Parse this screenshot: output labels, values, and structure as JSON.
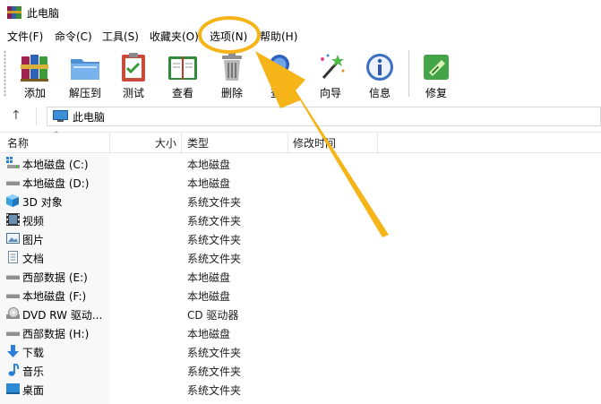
{
  "window": {
    "title": "此电脑"
  },
  "menu": [
    "文件(F)",
    "命令(C)",
    "工具(S)",
    "收藏夹(O)",
    "选项(N)",
    "帮助(H)"
  ],
  "toolbar": {
    "buttons": [
      {
        "label": "添加",
        "icon": "books-add-icon"
      },
      {
        "label": "解压到",
        "icon": "folder-extract-icon"
      },
      {
        "label": "测试",
        "icon": "clipboard-test-icon"
      },
      {
        "label": "查看",
        "icon": "open-book-view-icon"
      },
      {
        "label": "删除",
        "icon": "trash-delete-icon"
      },
      {
        "label": "查找",
        "icon": "magnifier-find-icon"
      },
      {
        "label": "向导",
        "icon": "magic-wand-wizard-icon"
      },
      {
        "label": "信息",
        "icon": "info-icon"
      },
      {
        "label": "修复",
        "icon": "first-aid-repair-icon"
      }
    ]
  },
  "address": {
    "path": "此电脑"
  },
  "columns": {
    "name": "名称",
    "size": "大小",
    "type": "类型",
    "modified": "修改时间"
  },
  "files": [
    {
      "name": "本地磁盘 (C:)",
      "type": "本地磁盘",
      "icon": "windows-drive-icon"
    },
    {
      "name": "本地磁盘 (D:)",
      "type": "本地磁盘",
      "icon": "drive-icon"
    },
    {
      "name": "3D 对象",
      "type": "系统文件夹",
      "icon": "3d-objects-icon"
    },
    {
      "name": "视频",
      "type": "系统文件夹",
      "icon": "video-icon"
    },
    {
      "name": "图片",
      "type": "系统文件夹",
      "icon": "pictures-icon"
    },
    {
      "name": "文档",
      "type": "系统文件夹",
      "icon": "document-icon"
    },
    {
      "name": "西部数据 (E:)",
      "type": "本地磁盘",
      "icon": "drive-icon"
    },
    {
      "name": "本地磁盘 (F:)",
      "type": "本地磁盘",
      "icon": "drive-icon"
    },
    {
      "name": "DVD RW 驱动...",
      "type": "CD 驱动器",
      "icon": "dvd-drive-icon"
    },
    {
      "name": "西部数据 (H:)",
      "type": "本地磁盘",
      "icon": "drive-icon"
    },
    {
      "name": "下载",
      "type": "系统文件夹",
      "icon": "download-icon"
    },
    {
      "name": "音乐",
      "type": "系统文件夹",
      "icon": "music-icon"
    },
    {
      "name": "桌面",
      "type": "系统文件夹",
      "icon": "desktop-icon"
    }
  ],
  "annotation": {
    "color": "#F5B418"
  }
}
